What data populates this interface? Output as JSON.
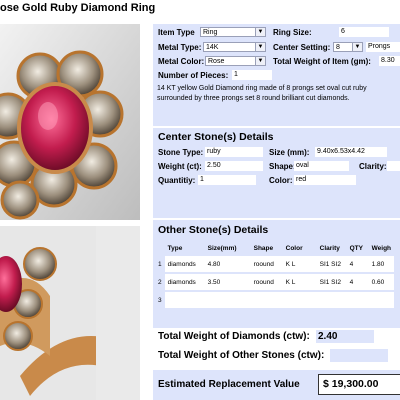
{
  "title": "ose Gold  Ruby Diamond Ring",
  "item": {
    "item_type_label": "Item Type",
    "item_type_value": "Ring",
    "ring_size_label": "Ring Size:",
    "ring_size_value": "6",
    "metal_type_label": "Metal Type:",
    "metal_type_value": "14K",
    "center_setting_label": "Center Setting:",
    "center_setting_value": "8",
    "prongs_value": "Prongs",
    "metal_color_label": "Metal Color:",
    "metal_color_value": "Rose",
    "total_weight_label": "Total Weight of Item (gm):",
    "total_weight_value": "8.30",
    "pieces_label": "Number of Pieces:",
    "pieces_value": "1",
    "description": "14 KT yellow  Gold Diamond ring made of 8 prongs set oval cut ruby surrounded by  three prongs set 8 round brilliant cut diamonds."
  },
  "center_stone": {
    "heading": "Center Stone(s) Details",
    "stone_type_label": "Stone Type:",
    "stone_type_value": "ruby",
    "size_label": "Size (mm):",
    "size_value": "9.40x6.53x4.42",
    "weight_label": "Weight (ct):",
    "weight_value": "2.50",
    "shape_label": "Shape:",
    "shape_value": "oval",
    "clarity_label": "Clarity:",
    "clarity_value": "",
    "quantity_label": "Quantitiy:",
    "quantity_value": "1",
    "color_label": "Color:",
    "color_value": "red"
  },
  "other_stones": {
    "heading": "Other Stone(s) Details",
    "columns": [
      "Type",
      "Size(mm)",
      "Shape",
      "Color",
      "Clarity",
      "QTY",
      "Weigh"
    ],
    "rows": [
      {
        "num": "1",
        "type": "diamonds",
        "size": "4.80",
        "shape": "roound",
        "color": "K L",
        "clarity": "SI1 SI2",
        "qty": "4",
        "weight": "1.80"
      },
      {
        "num": "2",
        "type": "diamonds",
        "size": "3.50",
        "shape": "roound",
        "color": "K L",
        "clarity": "SI1 SI2",
        "qty": "4",
        "weight": "0.60"
      },
      {
        "num": "3",
        "type": "",
        "size": "",
        "shape": "",
        "color": "",
        "clarity": "",
        "qty": "",
        "weight": ""
      }
    ]
  },
  "totals": {
    "diamonds_label": "Total Weight of Diamonds (ctw):",
    "diamonds_value": "2.40",
    "other_label": "Total Weight of Other Stones (ctw):",
    "other_value": "",
    "replacement_label": "Estimated Replacement Value",
    "replacement_value": "$ 19,300.00"
  },
  "colors": {
    "panel_bg": "#dde4fb",
    "gold": "#c98a4a",
    "ruby": "#c21d4e"
  },
  "icons": [
    "dropdown-arrow-icon"
  ]
}
